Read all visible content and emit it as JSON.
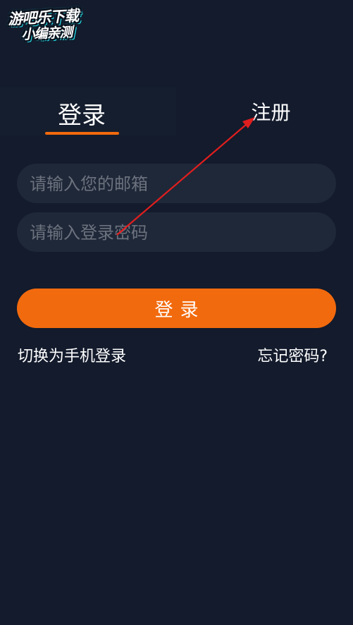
{
  "watermark": {
    "line1": "游吧乐下载",
    "line2": "小编亲测"
  },
  "tabs": {
    "login_label": "登录",
    "register_label": "注册",
    "active": "login"
  },
  "form": {
    "email_placeholder": "请输入您的邮箱",
    "email_value": "",
    "password_placeholder": "请输入登录密码",
    "password_value": "",
    "submit_label": "登录"
  },
  "links": {
    "switch_phone": "切换为手机登录",
    "forgot_password": "忘记密码?"
  },
  "colors": {
    "background": "#131b2c",
    "field_background": "#1f2838",
    "accent": "#f26a0e",
    "annotation_arrow": "#e01e1e"
  }
}
